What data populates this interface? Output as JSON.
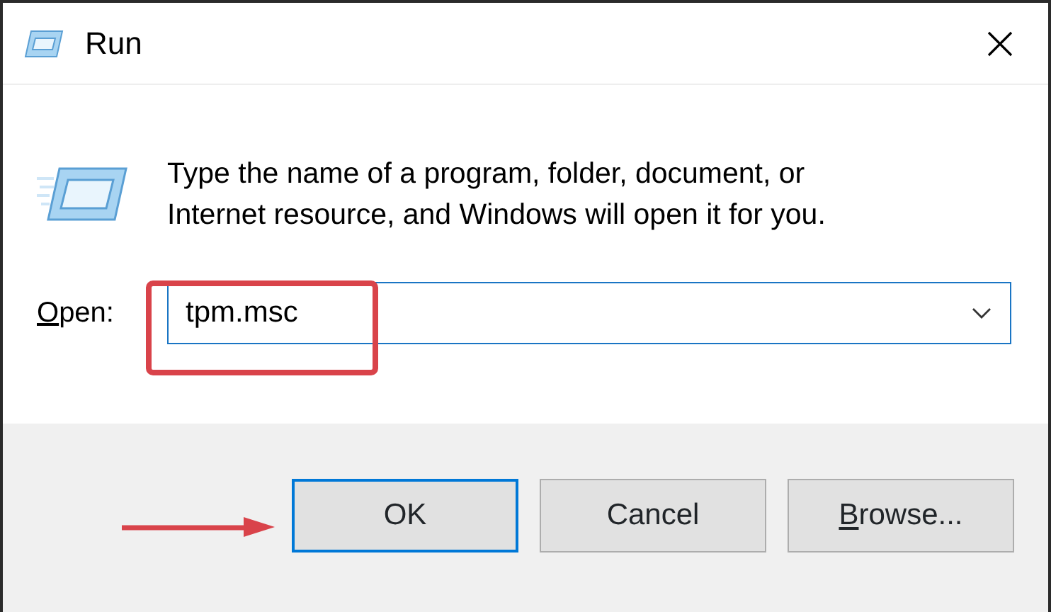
{
  "window": {
    "title": "Run"
  },
  "message": "Type the name of a program, folder, document, or Internet resource, and Windows will open it for you.",
  "open_field": {
    "label": {
      "key": "O",
      "rest": "pen:"
    },
    "value": "tpm.msc"
  },
  "buttons": [
    {
      "label": "OK",
      "focused": true
    },
    {
      "label": "Cancel",
      "focused": false
    },
    {
      "key": "B",
      "rest": "rowse...",
      "focused": false
    }
  ],
  "annotations": {
    "highlight_box": true,
    "arrow": true
  }
}
